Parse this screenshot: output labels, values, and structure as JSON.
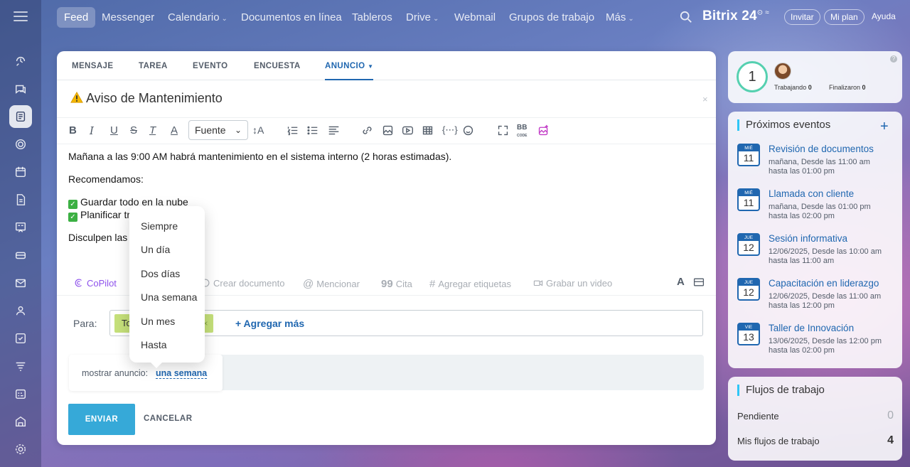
{
  "topbar": {
    "nav": [
      {
        "label": "Feed",
        "active": true
      },
      {
        "label": "Messenger"
      },
      {
        "label": "Calendario",
        "chevron": "⌄"
      },
      {
        "label": "Documentos en línea"
      },
      {
        "label": "Tableros"
      },
      {
        "label": "Drive",
        "chevron": "⌄"
      },
      {
        "label": "Webmail"
      },
      {
        "label": "Grupos de trabajo"
      },
      {
        "label": "Más",
        "chevron": "⌄"
      }
    ],
    "brand": "Bitrix 24",
    "invite": "Invitar",
    "my_plan": "Mi plan",
    "help": "Ayuda"
  },
  "composer": {
    "tabs": [
      "MENSAJE",
      "TAREA",
      "EVENTO",
      "ENCUESTA",
      "ANUNCIO"
    ],
    "active_tab": "ANUNCIO",
    "title": "Aviso de Mantenimiento",
    "font_select": "Fuente",
    "body": {
      "line1": "Mañana a las 9:00 AM habrá mantenimiento en el sistema interno (2 horas estimadas).",
      "line2": "Recomendamos:",
      "line3": "Guardar todo en la nube",
      "line4": "Planificar tr",
      "line5": "Disculpen las"
    },
    "actions": {
      "copilot": "CoPilot",
      "create_doc": "Crear documento",
      "mention": "Mencionar",
      "quote": "Cita",
      "tags": "Agregar etiquetas",
      "video": "Grabar un video"
    },
    "to_label": "Para:",
    "recipient_tag": "To",
    "recipient_tail": "os",
    "add_more": "+ Agregar más",
    "show_label": "mostrar anuncio:",
    "show_value": "una semana",
    "send": "ENVIAR",
    "cancel": "CANCELAR"
  },
  "duration_menu": {
    "items": [
      "Siempre",
      "Un día",
      "Dos días",
      "Una semana",
      "Un mes",
      "Hasta"
    ]
  },
  "stats_widget": {
    "counter": "1",
    "working_label": "Trabajando",
    "working_value": "0",
    "finished_label": "Finalizaron",
    "finished_value": "0"
  },
  "events_widget": {
    "title": "Próximos eventos",
    "events": [
      {
        "month": "MIÉ",
        "day": "11",
        "title": "Revisión de documentos",
        "line1": "mañana, Desde las 11:00 am",
        "line2": "hasta las 01:00 pm"
      },
      {
        "month": "MIÉ",
        "day": "11",
        "title": "Llamada con cliente",
        "line1": "mañana, Desde las 01:00 pm",
        "line2": "hasta las 02:00 pm"
      },
      {
        "month": "JUE",
        "day": "12",
        "title": "Sesión informativa",
        "line1": "12/06/2025, Desde las 10:00 am",
        "line2": "hasta las 11:00 am"
      },
      {
        "month": "JUE",
        "day": "12",
        "title": "Capacitación en liderazgo",
        "line1": "12/06/2025, Desde las 11:00 am",
        "line2": "hasta las 12:00 pm"
      },
      {
        "month": "VIE",
        "day": "13",
        "title": "Taller de Innovación",
        "line1": "13/06/2025, Desde las 12:00 pm",
        "line2": "hasta las 02:00 pm"
      }
    ]
  },
  "workflows_widget": {
    "title": "Flujos de trabajo",
    "pending_label": "Pendiente",
    "pending_value": "0",
    "mine_label": "Mis flujos de trabajo",
    "mine_value": "4"
  },
  "colors": {
    "accent": "#2067b0",
    "send": "#36a9d8",
    "tag": "#c5e07a"
  }
}
